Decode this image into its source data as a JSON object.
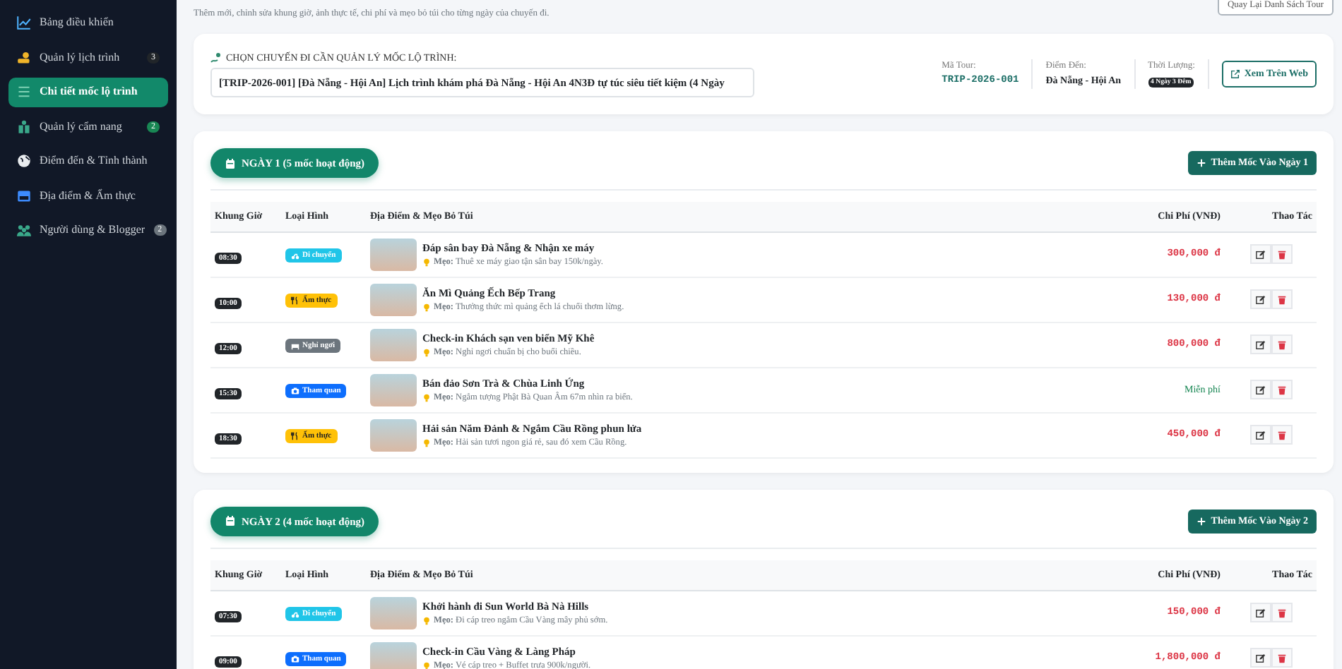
{
  "sidebar": {
    "items": [
      {
        "label": "Bảng điều khiển",
        "selected": false
      },
      {
        "label": "Quản lý lịch trình",
        "selected": false,
        "badge": "3",
        "color": "#212529"
      },
      {
        "label": "Chi tiết mốc lộ trình",
        "selected": true
      },
      {
        "label": "Quản lý cẩm nang",
        "selected": false,
        "badge": "2",
        "color": "#198754"
      },
      {
        "label": "Điểm đến & Tỉnh thành",
        "selected": false
      },
      {
        "label": "Địa điểm & Ẩm thực",
        "selected": false
      },
      {
        "label": "Người dùng & Blogger",
        "selected": false,
        "badge": "2",
        "color": "#6c757d"
      }
    ]
  },
  "header": {
    "subtitle": "Thêm mới, chỉnh sửa khung giờ, ảnh thực tế, chi phí và mẹo bỏ túi cho từng ngày của chuyến đi.",
    "back_button": "Quay Lại Danh Sách Tour"
  },
  "trip_selector": {
    "label": "CHỌN CHUYẾN ĐI CẦN QUẢN LÝ MỐC LỘ TRÌNH:",
    "value": "[TRIP-2026-001] [Đà Nẵng - Hội An] Lịch trình khám phá Đà Nẵng - Hội An 4N3Đ tự túc siêu tiết kiệm (4 Ngày",
    "info": [
      {
        "label": "Mã Tour:",
        "value": "TRIP-2026-001",
        "kind": "code"
      },
      {
        "label": "Điểm Đến:",
        "value": "Đà Nẵng - Hội An",
        "kind": "text"
      },
      {
        "label": "Thời Lượng:",
        "value": "4 Ngày 3 Đêm",
        "kind": "badge"
      }
    ],
    "web_button": "Xem Trên Web"
  },
  "days": [
    {
      "title": "NGÀY 1 (5 mốc hoạt động)",
      "add_button": "Thêm Mốc Vào Ngày 1",
      "columns": [
        "Khung Giờ",
        "Loại Hình",
        "Địa Điểm & Mẹo Bỏ Túi",
        "Chi Phí (VNĐ)",
        "Thao Tác"
      ],
      "rows": [
        {
          "time": "08:30",
          "type": "Di chuyển",
          "kind": "transport",
          "title": "Đáp sân bay Đà Nẵng & Nhận xe máy",
          "tip_label": "Mẹo:",
          "tip": "Thuê xe máy giao tận sân bay 150k/ngày.",
          "cost": "300,000 đ",
          "free": false
        },
        {
          "time": "10:00",
          "type": "Ẩm thực",
          "kind": "food",
          "title": "Ăn Mì Quảng Ếch Bếp Trang",
          "tip_label": "Mẹo:",
          "tip": "Thưởng thức mì quảng ếch lá chuối thơm lừng.",
          "cost": "130,000 đ",
          "free": false
        },
        {
          "time": "12:00",
          "type": "Nghỉ ngơi",
          "kind": "rest",
          "title": "Check-in Khách sạn ven biển Mỹ Khê",
          "tip_label": "Mẹo:",
          "tip": "Nghỉ ngơi chuẩn bị cho buổi chiều.",
          "cost": "800,000 đ",
          "free": false
        },
        {
          "time": "15:30",
          "type": "Tham quan",
          "kind": "sightseeing",
          "title": "Bán đảo Sơn Trà & Chùa Linh Ứng",
          "tip_label": "Mẹo:",
          "tip": "Ngắm tượng Phật Bà Quan Âm 67m nhìn ra biển.",
          "cost": "Miễn phí",
          "free": true
        },
        {
          "time": "18:30",
          "type": "Ẩm thực",
          "kind": "food",
          "title": "Hải sản Năm Đảnh & Ngắm Cầu Rồng phun lửa",
          "tip_label": "Mẹo:",
          "tip": "Hải sản tươi ngon giá rẻ, sau đó xem Cầu Rồng.",
          "cost": "450,000 đ",
          "free": false
        }
      ]
    },
    {
      "title": "NGÀY 2 (4 mốc hoạt động)",
      "add_button": "Thêm Mốc Vào Ngày 2",
      "columns": [
        "Khung Giờ",
        "Loại Hình",
        "Địa Điểm & Mẹo Bỏ Túi",
        "Chi Phí (VNĐ)",
        "Thao Tác"
      ],
      "rows": [
        {
          "time": "07:30",
          "type": "Di chuyển",
          "kind": "transport",
          "title": "Khởi hành đi Sun World Bà Nà Hills",
          "tip_label": "Mẹo:",
          "tip": "Đi cáp treo ngắm Cầu Vàng mây phủ sớm.",
          "cost": "150,000 đ",
          "free": false
        },
        {
          "time": "09:00",
          "type": "Tham quan",
          "kind": "sightseeing",
          "title": "Check-in Cầu Vàng & Làng Pháp",
          "tip_label": "Mẹo:",
          "tip": "Vé cáp treo + Buffet trưa 900k/người.",
          "cost": "1,800,000 đ",
          "free": false
        }
      ]
    }
  ]
}
